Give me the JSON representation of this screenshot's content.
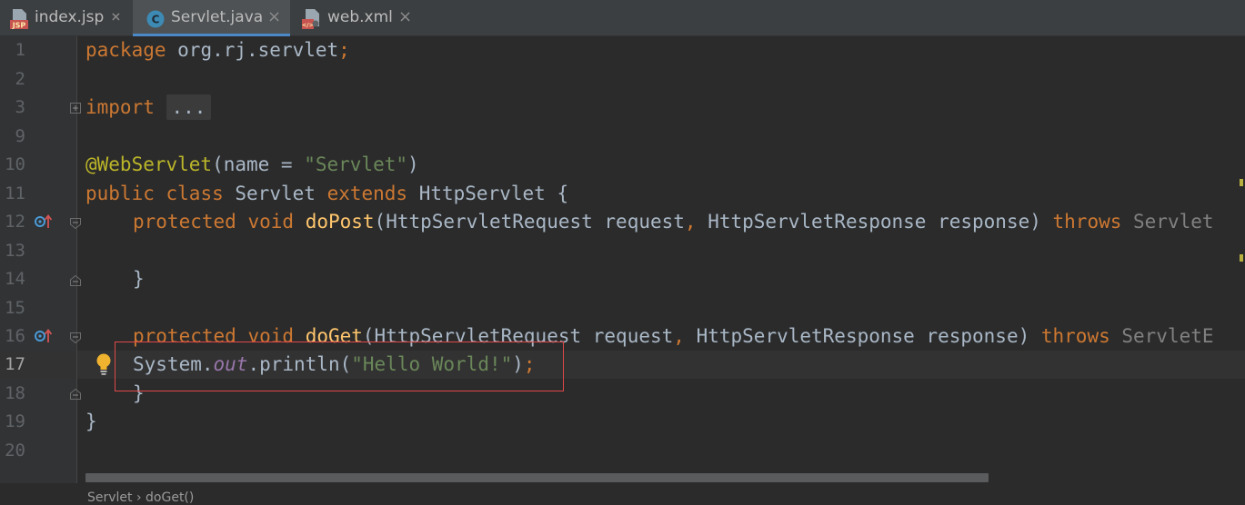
{
  "tabs": [
    {
      "label": "index.jsp",
      "icon": "jsp-file-icon",
      "icon_text": "JSP",
      "active": false
    },
    {
      "label": "Servlet.java",
      "icon": "java-class-icon",
      "icon_text": "C",
      "active": true
    },
    {
      "label": "web.xml",
      "icon": "xml-file-icon",
      "icon_text": "</>",
      "active": false
    }
  ],
  "close_glyph": "×",
  "line_numbers": [
    "1",
    "2",
    "3",
    "9",
    "10",
    "11",
    "12",
    "13",
    "14",
    "15",
    "16",
    "17",
    "18",
    "19",
    "20"
  ],
  "current_line": "17",
  "code": {
    "l1_kw": "package",
    "l1_rest": " org.rj.servlet",
    "l1_semi": ";",
    "l3_kw": "import",
    "l3_dots": "...",
    "l10_ann": "@WebServlet",
    "l10_open": "(name = ",
    "l10_str": "\"Servlet\"",
    "l10_close": ")",
    "l11_kw1": "public",
    "l11_kw2": "class",
    "l11_name": "Servlet",
    "l11_kw3": "extends",
    "l11_rest": " HttpServlet {",
    "l12_kw1": "protected",
    "l12_kw2": "void",
    "l12_fn": "doPost",
    "l12_args1": "(HttpServletRequest request",
    "l12_comma": ",",
    "l12_args2": " HttpServletResponse response) ",
    "l12_throws": "throws",
    "l12_exc": " Servlet",
    "l14_brace": "}",
    "l16_kw1": "protected",
    "l16_kw2": "void",
    "l16_fn": "doGet",
    "l16_args1": "(HttpServletRequest request",
    "l16_comma": ",",
    "l16_args2": " HttpServletResponse response) ",
    "l16_throws": "throws",
    "l16_exc": " ServletE",
    "l17_sys": "System.",
    "l17_out": "out",
    "l17_call": ".println(",
    "l17_str": "\"Hello World!\"",
    "l17_close": ")",
    "l17_semi": ";",
    "l18_brace": "}",
    "l19_brace": "}"
  },
  "bottom_breadcrumb": "Servlet › doGet()",
  "colors": {
    "keyword": "#cc7832",
    "string": "#6a8759",
    "annotation": "#bbb529",
    "method": "#ffc66d",
    "static_field": "#9876aa",
    "highlight_box": "#e04848",
    "active_tab_underline": "#4a88c7"
  }
}
